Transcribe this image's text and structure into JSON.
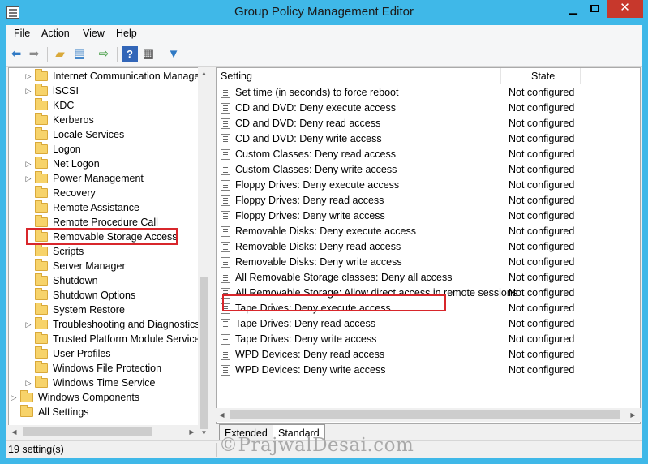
{
  "window": {
    "title": "Group Policy Management Editor",
    "minimize_glyph": "▁",
    "close_glyph": "✕"
  },
  "menu": [
    "File",
    "Action",
    "View",
    "Help"
  ],
  "toolbar": {
    "icons": [
      "back-arrow-icon",
      "forward-arrow-icon",
      "up-folder-icon",
      "show-hide-tree-icon",
      "export-list-icon",
      "help-icon",
      "properties-icon",
      "filter-icon"
    ]
  },
  "tree": {
    "items": [
      {
        "label": "Internet Communication Management",
        "expandable": true
      },
      {
        "label": "iSCSI",
        "expandable": true
      },
      {
        "label": "KDC",
        "expandable": false
      },
      {
        "label": "Kerberos",
        "expandable": false
      },
      {
        "label": "Locale Services",
        "expandable": false
      },
      {
        "label": "Logon",
        "expandable": false
      },
      {
        "label": "Net Logon",
        "expandable": true
      },
      {
        "label": "Power Management",
        "expandable": true
      },
      {
        "label": "Recovery",
        "expandable": false
      },
      {
        "label": "Remote Assistance",
        "expandable": false
      },
      {
        "label": "Remote Procedure Call",
        "expandable": false
      },
      {
        "label": "Removable Storage Access",
        "expandable": false,
        "selected": true
      },
      {
        "label": "Scripts",
        "expandable": false
      },
      {
        "label": "Server Manager",
        "expandable": false
      },
      {
        "label": "Shutdown",
        "expandable": false
      },
      {
        "label": "Shutdown Options",
        "expandable": false
      },
      {
        "label": "System Restore",
        "expandable": false
      },
      {
        "label": "Troubleshooting and Diagnostics",
        "expandable": true
      },
      {
        "label": "Trusted Platform Module Services",
        "expandable": false
      },
      {
        "label": "User Profiles",
        "expandable": false
      },
      {
        "label": "Windows File Protection",
        "expandable": false
      },
      {
        "label": "Windows Time Service",
        "expandable": true
      },
      {
        "label": "Windows Components",
        "expandable": true,
        "level": 0
      },
      {
        "label": "All Settings",
        "expandable": false,
        "level": 0
      }
    ]
  },
  "list": {
    "columns": {
      "setting": "Setting",
      "state": "State"
    },
    "rows": [
      {
        "setting": "Set time (in seconds) to force reboot",
        "state": "Not configured"
      },
      {
        "setting": "CD and DVD: Deny execute access",
        "state": "Not configured"
      },
      {
        "setting": "CD and DVD: Deny read access",
        "state": "Not configured"
      },
      {
        "setting": "CD and DVD: Deny write access",
        "state": "Not configured"
      },
      {
        "setting": "Custom Classes: Deny read access",
        "state": "Not configured"
      },
      {
        "setting": "Custom Classes: Deny write access",
        "state": "Not configured"
      },
      {
        "setting": "Floppy Drives: Deny execute access",
        "state": "Not configured"
      },
      {
        "setting": "Floppy Drives: Deny read access",
        "state": "Not configured"
      },
      {
        "setting": "Floppy Drives: Deny write access",
        "state": "Not configured"
      },
      {
        "setting": "Removable Disks: Deny execute access",
        "state": "Not configured"
      },
      {
        "setting": "Removable Disks: Deny read access",
        "state": "Not configured"
      },
      {
        "setting": "Removable Disks: Deny write access",
        "state": "Not configured"
      },
      {
        "setting": "All Removable Storage classes: Deny all access",
        "state": "Not configured",
        "highlighted": true
      },
      {
        "setting": "All Removable Storage: Allow direct access in remote sessions",
        "state": "Not configured"
      },
      {
        "setting": "Tape Drives: Deny execute access",
        "state": "Not configured"
      },
      {
        "setting": "Tape Drives: Deny read access",
        "state": "Not configured"
      },
      {
        "setting": "Tape Drives: Deny write access",
        "state": "Not configured"
      },
      {
        "setting": "WPD Devices: Deny read access",
        "state": "Not configured"
      },
      {
        "setting": "WPD Devices: Deny write access",
        "state": "Not configured"
      }
    ]
  },
  "tabs": [
    "Extended",
    "Standard"
  ],
  "active_tab": "Standard",
  "status": {
    "text": "19 setting(s)"
  },
  "watermark": "©PrajwalDesai.com",
  "colors": {
    "title_bar": "#3fb8e8",
    "highlight_box": "#d8262b",
    "close_button": "#c7382c",
    "folder": "#f7d36a"
  }
}
